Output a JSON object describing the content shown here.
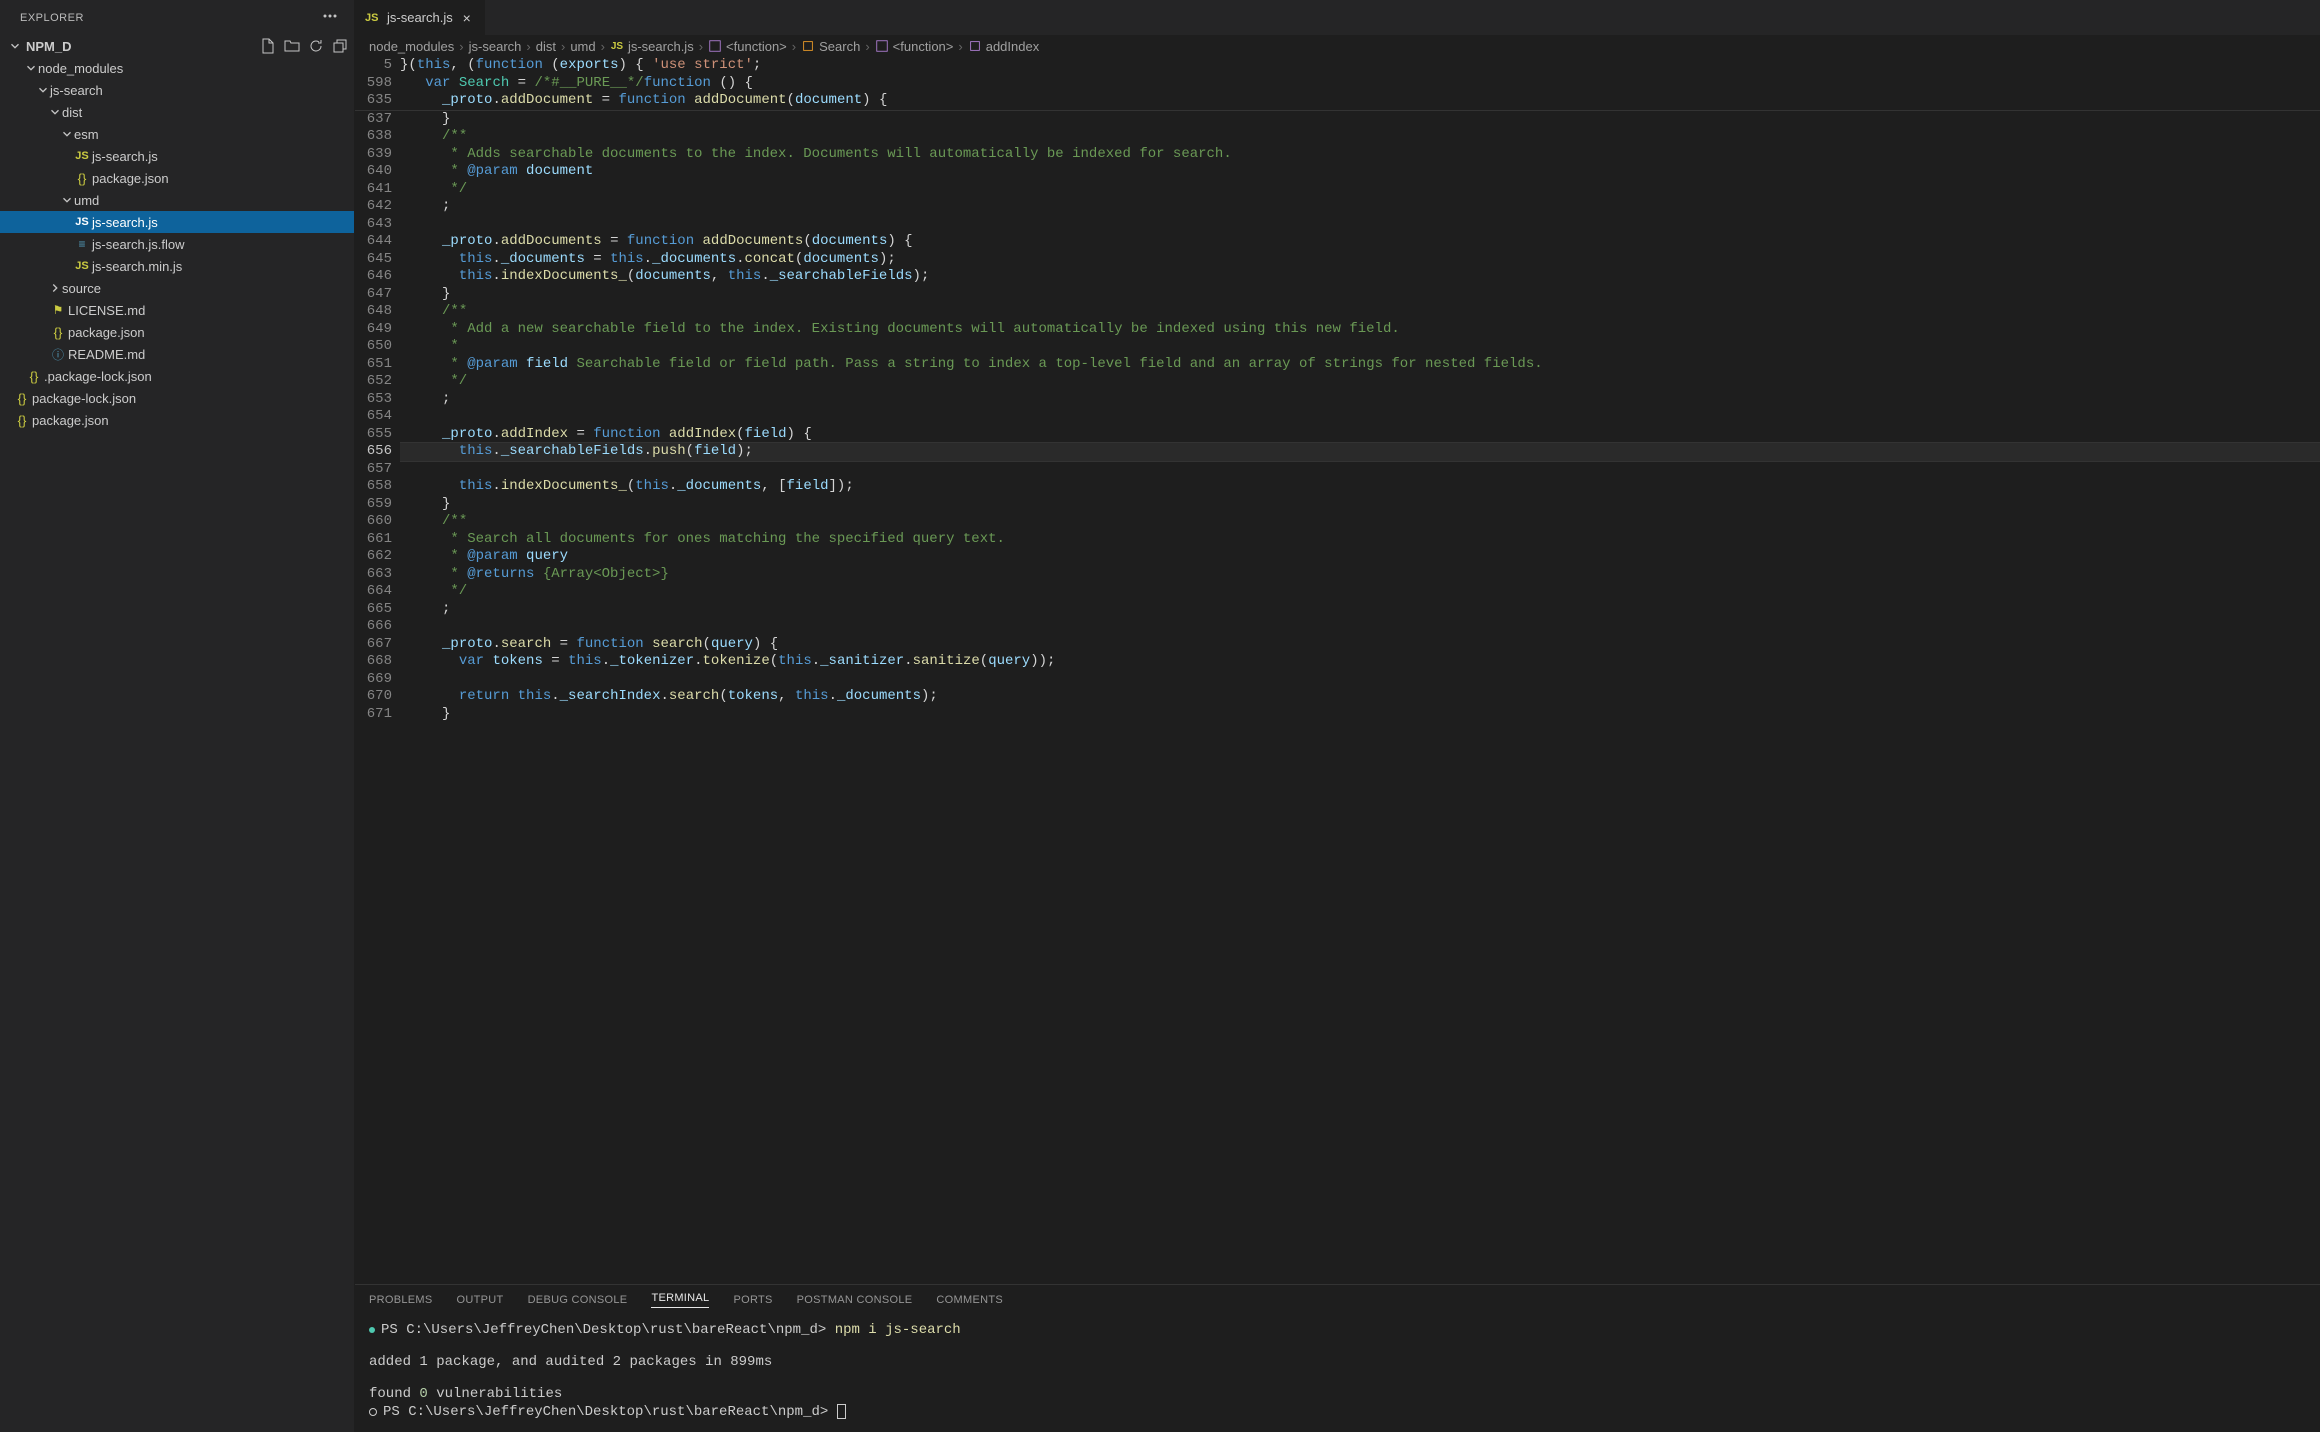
{
  "explorer": {
    "title": "EXPLORER",
    "root": "NPM_D",
    "actions": {
      "newfile": "New File",
      "newfolder": "New Folder",
      "refresh": "Refresh",
      "collapse": "Collapse"
    },
    "tree": [
      {
        "depth": 1,
        "open": true,
        "folder": true,
        "name": "node_modules"
      },
      {
        "depth": 2,
        "open": true,
        "folder": true,
        "name": "js-search"
      },
      {
        "depth": 3,
        "open": true,
        "folder": true,
        "name": "dist"
      },
      {
        "depth": 4,
        "open": true,
        "folder": true,
        "name": "esm"
      },
      {
        "depth": 5,
        "open": false,
        "folder": false,
        "icon": "js",
        "name": "js-search.js"
      },
      {
        "depth": 5,
        "open": false,
        "folder": false,
        "icon": "json",
        "name": "package.json"
      },
      {
        "depth": 4,
        "open": true,
        "folder": true,
        "name": "umd"
      },
      {
        "depth": 5,
        "open": false,
        "folder": false,
        "icon": "js",
        "name": "js-search.js",
        "selected": true
      },
      {
        "depth": 5,
        "open": false,
        "folder": false,
        "icon": "flow",
        "name": "js-search.js.flow"
      },
      {
        "depth": 5,
        "open": false,
        "folder": false,
        "icon": "js",
        "name": "js-search.min.js"
      },
      {
        "depth": 3,
        "open": false,
        "folder": true,
        "collapsed": true,
        "name": "source"
      },
      {
        "depth": 3,
        "open": false,
        "folder": false,
        "icon": "license",
        "name": "LICENSE.md"
      },
      {
        "depth": 3,
        "open": false,
        "folder": false,
        "icon": "json",
        "name": "package.json"
      },
      {
        "depth": 3,
        "open": false,
        "folder": false,
        "icon": "md",
        "name": "README.md"
      },
      {
        "depth": 1,
        "open": false,
        "folder": false,
        "icon": "json",
        "name": ".package-lock.json"
      },
      {
        "depth": 0,
        "open": false,
        "folder": false,
        "icon": "json",
        "name": "package-lock.json"
      },
      {
        "depth": 0,
        "open": false,
        "folder": false,
        "icon": "json",
        "name": "package.json"
      }
    ]
  },
  "tab": {
    "label": "js-search.js"
  },
  "breadcrumb": [
    {
      "t": "node_modules"
    },
    {
      "t": "js-search"
    },
    {
      "t": "dist"
    },
    {
      "t": "umd"
    },
    {
      "t": "js-search.js",
      "i": "js"
    },
    {
      "t": "<function>",
      "i": "func"
    },
    {
      "t": "Search",
      "i": "class"
    },
    {
      "t": "<function>",
      "i": "func"
    },
    {
      "t": "addIndex",
      "i": "method"
    }
  ],
  "sticky": [
    {
      "ln": 5,
      "html": "<span class='hl-op'>}(</span><span class='hl-this'>this</span><span class='hl-op'>, (</span><span class='hl-kw'>function</span> <span class='hl-op'>(</span><span class='hl-prm'>exports</span><span class='hl-op'>) { </span><span class='hl-str'>'use strict'</span><span class='hl-op'>;</span>"
    },
    {
      "ln": 598,
      "html": "   <span class='hl-kw'>var</span> <span class='hl-type'>Search</span> <span class='hl-op'>= </span><span class='hl-cmt'>/*#__PURE__*/</span><span class='hl-kw'>function</span> <span class='hl-op'>() {</span>"
    },
    {
      "ln": 635,
      "html": "     <span class='hl-prm'>_proto</span><span class='hl-op'>.</span><span class='hl-fn'>addDocument</span> <span class='hl-op'>= </span><span class='hl-kw'>function</span> <span class='hl-fn'>addDocument</span><span class='hl-op'>(</span><span class='hl-prm'>document</span><span class='hl-op'>) {</span>"
    }
  ],
  "code": [
    {
      "ln": 637,
      "html": "     <span class='hl-op'>}</span>"
    },
    {
      "ln": 638,
      "html": "     <span class='hl-cmt'>/**</span>"
    },
    {
      "ln": 639,
      "html": "<span class='hl-cmt'>      * Adds searchable documents to the index. Documents will automatically be indexed for search.</span>"
    },
    {
      "ln": 640,
      "html": "<span class='hl-cmt'>      * </span><span class='hl-doc'>@param</span> <span class='hl-prm'>document</span>"
    },
    {
      "ln": 641,
      "html": "<span class='hl-cmt'>      */</span>"
    },
    {
      "ln": 642,
      "html": "     <span class='hl-op'>;</span>"
    },
    {
      "ln": 643,
      "html": ""
    },
    {
      "ln": 644,
      "html": "     <span class='hl-prm'>_proto</span><span class='hl-op'>.</span><span class='hl-fn'>addDocuments</span> <span class='hl-op'>= </span><span class='hl-kw'>function</span> <span class='hl-fn'>addDocuments</span><span class='hl-op'>(</span><span class='hl-prm'>documents</span><span class='hl-op'>) {</span>"
    },
    {
      "ln": 645,
      "html": "       <span class='hl-this'>this</span><span class='hl-op'>.</span><span class='hl-prm'>_documents</span> <span class='hl-op'>= </span><span class='hl-this'>this</span><span class='hl-op'>.</span><span class='hl-prm'>_documents</span><span class='hl-op'>.</span><span class='hl-fn'>concat</span><span class='hl-op'>(</span><span class='hl-prm'>documents</span><span class='hl-op'>);</span>"
    },
    {
      "ln": 646,
      "html": "       <span class='hl-this'>this</span><span class='hl-op'>.</span><span class='hl-fn'>indexDocuments_</span><span class='hl-op'>(</span><span class='hl-prm'>documents</span><span class='hl-op'>, </span><span class='hl-this'>this</span><span class='hl-op'>.</span><span class='hl-prm'>_searchableFields</span><span class='hl-op'>);</span>"
    },
    {
      "ln": 647,
      "html": "     <span class='hl-op'>}</span>"
    },
    {
      "ln": 648,
      "html": "     <span class='hl-cmt'>/**</span>"
    },
    {
      "ln": 649,
      "html": "<span class='hl-cmt'>      * Add a new searchable field to the index. Existing documents will automatically be indexed using this new field.</span>"
    },
    {
      "ln": 650,
      "html": "<span class='hl-cmt'>      *</span>"
    },
    {
      "ln": 651,
      "html": "<span class='hl-cmt'>      * </span><span class='hl-doc'>@param</span> <span class='hl-prm'>field</span><span class='hl-cmt'> Searchable field or field path. Pass a string to index a top-level field and an array of strings for nested fields.</span>"
    },
    {
      "ln": 652,
      "html": "<span class='hl-cmt'>      */</span>"
    },
    {
      "ln": 653,
      "html": "     <span class='hl-op'>;</span>"
    },
    {
      "ln": 654,
      "html": ""
    },
    {
      "ln": 655,
      "html": "     <span class='hl-prm'>_proto</span><span class='hl-op'>.</span><span class='hl-fn'>addIndex</span> <span class='hl-op'>= </span><span class='hl-kw'>function</span> <span class='hl-fn'>addIndex</span><span class='hl-op'>(</span><span class='hl-prm'>field</span><span class='hl-op'>) {</span>"
    },
    {
      "ln": 656,
      "cur": true,
      "html": "       <span class='hl-this'>this</span><span class='hl-op'>.</span><span class='hl-prm'>_searchableFields</span><span class='hl-op'>.</span><span class='hl-fn'>push</span><span class='hl-op'>(</span><span class='hl-prm'>field</span><span class='hl-op'>);</span>"
    },
    {
      "ln": 657,
      "html": ""
    },
    {
      "ln": 658,
      "html": "       <span class='hl-this'>this</span><span class='hl-op'>.</span><span class='hl-fn'>indexDocuments_</span><span class='hl-op'>(</span><span class='hl-this'>this</span><span class='hl-op'>.</span><span class='hl-prm'>_documents</span><span class='hl-op'>, [</span><span class='hl-prm'>field</span><span class='hl-op'>]);</span>"
    },
    {
      "ln": 659,
      "html": "     <span class='hl-op'>}</span>"
    },
    {
      "ln": 660,
      "html": "     <span class='hl-cmt'>/**</span>"
    },
    {
      "ln": 661,
      "html": "<span class='hl-cmt'>      * Search all documents for ones matching the specified query text.</span>"
    },
    {
      "ln": 662,
      "html": "<span class='hl-cmt'>      * </span><span class='hl-doc'>@param</span> <span class='hl-prm'>query</span>"
    },
    {
      "ln": 663,
      "html": "<span class='hl-cmt'>      * </span><span class='hl-doc'>@returns</span><span class='hl-cmt'> {Array&lt;Object&gt;}</span>"
    },
    {
      "ln": 664,
      "html": "<span class='hl-cmt'>      */</span>"
    },
    {
      "ln": 665,
      "html": "     <span class='hl-op'>;</span>"
    },
    {
      "ln": 666,
      "html": ""
    },
    {
      "ln": 667,
      "html": "     <span class='hl-prm'>_proto</span><span class='hl-op'>.</span><span class='hl-fn'>search</span> <span class='hl-op'>= </span><span class='hl-kw'>function</span> <span class='hl-fn'>search</span><span class='hl-op'>(</span><span class='hl-prm'>query</span><span class='hl-op'>) {</span>"
    },
    {
      "ln": 668,
      "html": "       <span class='hl-kw'>var</span> <span class='hl-prm'>tokens</span> <span class='hl-op'>= </span><span class='hl-this'>this</span><span class='hl-op'>.</span><span class='hl-prm'>_tokenizer</span><span class='hl-op'>.</span><span class='hl-fn'>tokenize</span><span class='hl-op'>(</span><span class='hl-this'>this</span><span class='hl-op'>.</span><span class='hl-prm'>_sanitizer</span><span class='hl-op'>.</span><span class='hl-fn'>sanitize</span><span class='hl-op'>(</span><span class='hl-prm'>query</span><span class='hl-op'>));</span>"
    },
    {
      "ln": 669,
      "html": ""
    },
    {
      "ln": 670,
      "html": "       <span class='hl-kw'>return</span> <span class='hl-this'>this</span><span class='hl-op'>.</span><span class='hl-prm'>_searchIndex</span><span class='hl-op'>.</span><span class='hl-fn'>search</span><span class='hl-op'>(</span><span class='hl-prm'>tokens</span><span class='hl-op'>, </span><span class='hl-this'>this</span><span class='hl-op'>.</span><span class='hl-prm'>_documents</span><span class='hl-op'>);</span>"
    },
    {
      "ln": 671,
      "html": "     <span class='hl-op'>}</span>"
    }
  ],
  "panel": {
    "tabs": [
      "PROBLEMS",
      "OUTPUT",
      "DEBUG CONSOLE",
      "TERMINAL",
      "PORTS",
      "POSTMAN CONSOLE",
      "COMMENTS"
    ],
    "active": "TERMINAL",
    "terminal": {
      "prompt": "PS C:\\Users\\JeffreyChen\\Desktop\\rust\\bareReact\\npm_d>",
      "cmd": "npm i js-search",
      "line1": "added 1 package, and audited 2 packages in 899ms",
      "line2_pre": "found ",
      "line2_num": "0",
      "line2_post": " vulnerabilities"
    }
  }
}
